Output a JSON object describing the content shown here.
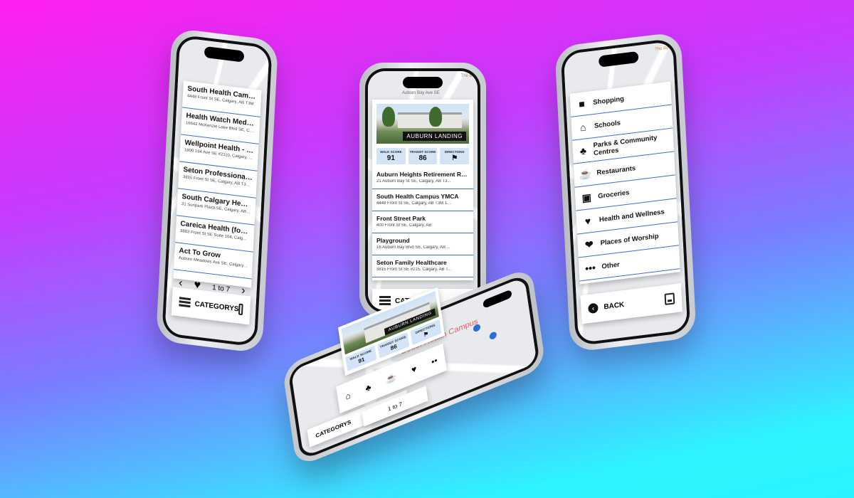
{
  "colors": {
    "accent": "#3e6fc1",
    "score_bg": "#d4e4f7"
  },
  "left_phone": {
    "list": [
      {
        "title": "South Health Campus",
        "address": "4448 Front St SE, Calgary, AB T3M"
      },
      {
        "title": "Health Watch Medical C...",
        "address": "16642 McKenzie Lake Blvd SE, Calgary..."
      },
      {
        "title": "Wellpoint Health - Calg...",
        "address": "1800 194 Ave SE #2110, Calgary, AB T..."
      },
      {
        "title": "Seton Professional Hea...",
        "address": "3815 Front St SE, Calgary, AB T3M 2..."
      },
      {
        "title": "South Calgary Health C...",
        "address": "31 Sunpark Plaza SE, Calgary, AB T2X..."
      },
      {
        "title": "Careica Health (formerl...",
        "address": "3883 Front St SE Suite 104, Calgary, A..."
      },
      {
        "title": "Act To Grow",
        "address": "Auburn Meadows Ave SE, Calgary, AB ..."
      }
    ],
    "pager_text": "1 to 7",
    "prev_icon": "chevron-left-icon",
    "next_icon": "chevron-right-icon",
    "bar_label": "CATEGORYS"
  },
  "center_phone": {
    "road": "Auburn Bay Ave SE",
    "photo_label": "AUBURN LANDING",
    "scores": [
      {
        "label": "WALK SCORE",
        "value": "91"
      },
      {
        "label": "TRANSIT SCORE",
        "value": "86"
      },
      {
        "label": "DIRECTIONS",
        "value": "⚑"
      }
    ],
    "list": [
      {
        "title": "Auburn Heights Retirement Res...",
        "address": "21 Auburn Bay St SE, Calgary, AB T3..."
      },
      {
        "title": "South Health Campus YMCA",
        "address": "4448 Front St SE, Calgary, AB T3M 1..."
      },
      {
        "title": "Front Street Park",
        "address": "400 Front St SE, Calgary, AB"
      },
      {
        "title": "Playground",
        "address": "16 Auburn Bay Blvd SE, Calgary, AB ..."
      },
      {
        "title": "Seton Family Healthcare",
        "address": "3815 Front St SE #215, Calgary, AB T..."
      }
    ],
    "bar_label": "CATEGORYS",
    "corner_label": "The Be"
  },
  "right_phone": {
    "categories": [
      {
        "label": "Shopping",
        "icon": "shopping-bag-icon",
        "glyph": "■"
      },
      {
        "label": "Schools",
        "icon": "school-icon",
        "glyph": "⌂"
      },
      {
        "label": "Parks & Community Centres",
        "icon": "tree-icon",
        "glyph": "♣"
      },
      {
        "label": "Restaurants",
        "icon": "coffee-cup-icon",
        "glyph": "☕"
      },
      {
        "label": "Groceries",
        "icon": "grocery-basket-icon",
        "glyph": "▣"
      },
      {
        "label": "Health and Wellness",
        "icon": "heart-plus-icon",
        "glyph": "♥"
      },
      {
        "label": "Places of Worship",
        "icon": "hands-heart-icon",
        "glyph": "❤"
      },
      {
        "label": "Other",
        "icon": "more-dots-icon",
        "glyph": "•••"
      }
    ],
    "back_label": "BACK",
    "corner_label": "The Be"
  },
  "front_phone": {
    "map_label": "South Health Campus",
    "photo_label": "AUBURN LANDING",
    "walk_score_label": "WALK SCORE",
    "walk_score": "91",
    "transit_score_label": "TRANSIT SCORE",
    "transit_score": "86",
    "directions_label": "DIRECTIONS",
    "pager_text": "1 to 7",
    "bar_label": "CATEGORYS"
  }
}
